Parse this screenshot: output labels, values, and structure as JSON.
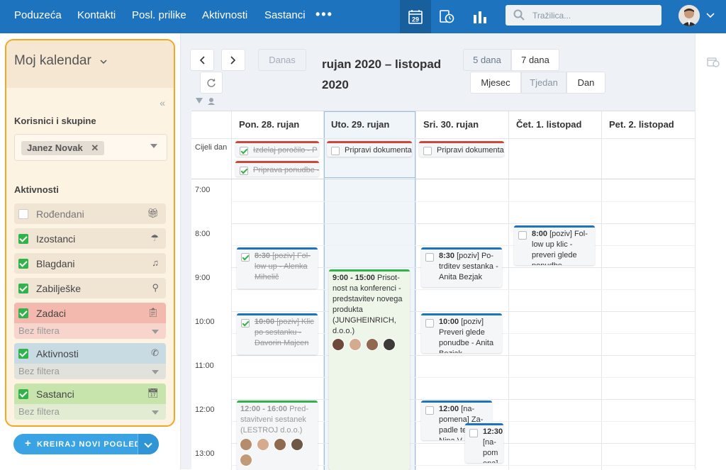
{
  "nav": {
    "items": [
      "Poduzeća",
      "Kontakti",
      "Posl. prilike",
      "Aktivnosti",
      "Sastanci"
    ],
    "more": "•••",
    "calendar_day": "29",
    "search_placeholder": "Tražilica..."
  },
  "sidebar": {
    "title": "Moj kalendar",
    "users_label": "Korisnici i skupine",
    "selected_user": "Janez Novak",
    "activities_label": "Aktivnosti",
    "items": [
      {
        "label": "Rođendani",
        "checked": false,
        "icon": "gift-icon",
        "color": "#f0e4d3"
      },
      {
        "label": "Izostanci",
        "checked": true,
        "icon": "umbrella-icon",
        "color": "#f0e4d3"
      },
      {
        "label": "Blagdani",
        "checked": true,
        "icon": "bell-icon",
        "color": "#f0e4d3"
      },
      {
        "label": "Zabilješke",
        "checked": true,
        "icon": "pin-icon",
        "color": "#f0e4d3"
      },
      {
        "label": "Zadaci",
        "checked": true,
        "icon": "clipboard-icon",
        "color": "#f4b9ae",
        "filter": "Bez filtera"
      },
      {
        "label": "Aktivnosti",
        "checked": true,
        "icon": "phone-icon",
        "color": "#c9dbe2",
        "filter": "Bez filtera"
      },
      {
        "label": "Sastanci",
        "checked": true,
        "icon": "calendar-icon",
        "color": "#c8e4ad",
        "filter": "Bez filtera"
      }
    ],
    "create_button": "KREIRAJ NOVI POGLED"
  },
  "toolbar": {
    "today": "Danas",
    "range_line1": "rujan 2020 – listopad",
    "range_line2": "2020",
    "view_5": "5 dana",
    "view_7": "7 dana",
    "month": "Mjesec",
    "week": "Tjedan",
    "day": "Dan"
  },
  "calendar": {
    "allday_label": "Cijeli dan",
    "days": [
      "Pon. 28. rujan",
      "Uto. 29. rujan",
      "Sri. 30. rujan",
      "Čet. 1. listopad",
      "Pet. 2. listopad"
    ],
    "times": [
      "7:00",
      "8:00",
      "9:00",
      "10:00",
      "11:00",
      "12:00",
      "13:00"
    ],
    "allday_events": [
      {
        "text": "Izdelaj poročilo - P",
        "done": true
      },
      {
        "text": "Priprava ponudbe -",
        "done": true
      },
      {
        "text": "Pripravi dokumenta",
        "done": false
      },
      {
        "text": "Pripravi dokumenta",
        "done": false
      }
    ],
    "events": [
      {
        "time": "8:30",
        "text": "[poziv] Fol-low up - Alenka Mihelič",
        "done": true
      },
      {
        "time": "10:00",
        "text": "[poziv] Klic po sestanku - Davorin Majcen",
        "done": true
      },
      {
        "time": "12:00 - 16:00",
        "text": "Pred-stavitveni sestanek (LESTROJ d.o.o.)"
      },
      {
        "time": "9:00 - 15:00",
        "text": "Prisot-nost na konferenci - predstavitev novega produkta (JUNGHEINRICH, d.o.o.)"
      },
      {
        "time": "8:30",
        "text": "[poziv] Po-trditev sestanka - Anita Bezjak"
      },
      {
        "time": "10:00",
        "text": "[poziv] Preveri glede ponudbe - Anita Bezjak"
      },
      {
        "time": "12:00",
        "text": "[na-pomena] Za-padle te... Nina V..."
      },
      {
        "time": "12:30",
        "text": "[na-pom ena]"
      },
      {
        "time": "8:00",
        "text": "[poziv] Fol-low up klic - preveri glede ponudbe"
      }
    ]
  }
}
